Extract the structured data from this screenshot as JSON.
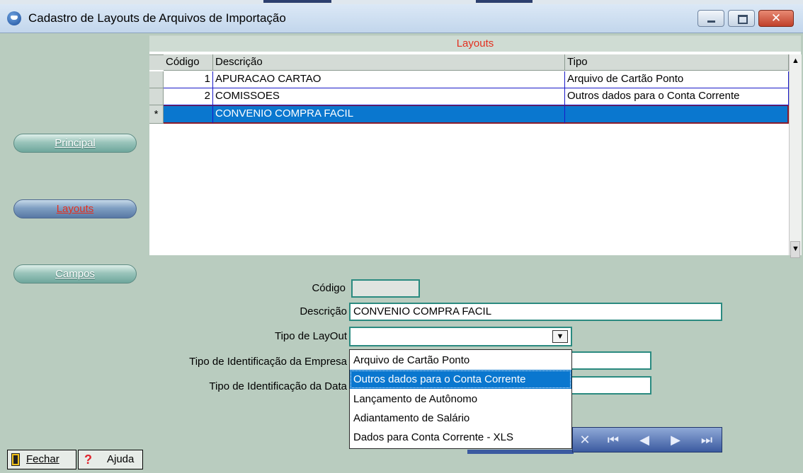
{
  "window": {
    "title": "Cadastro de Layouts de Arquivos de Importação"
  },
  "sidebar": {
    "items": [
      {
        "label": "Principal",
        "active": false
      },
      {
        "label": "Layouts",
        "active": true
      },
      {
        "label": "Campos",
        "active": false
      }
    ],
    "close_label": "Fechar",
    "help_label": "Ajuda"
  },
  "grid": {
    "caption": "Layouts",
    "columns": [
      "Código",
      "Descrição",
      "Tipo"
    ],
    "new_row_marker": "*",
    "rows": [
      {
        "codigo": "1",
        "descricao": "APURACAO CARTAO",
        "tipo": "Arquivo de Cartão Ponto"
      },
      {
        "codigo": "2",
        "descricao": "COMISSOES",
        "tipo": "Outros dados para o Conta Corrente"
      },
      {
        "codigo": "",
        "descricao": "CONVENIO COMPRA FACIL",
        "tipo": ""
      }
    ],
    "selected_row": 2
  },
  "form": {
    "codigo_label": "Código",
    "codigo_value": "",
    "descricao_label": "Descrição",
    "descricao_value": "CONVENIO COMPRA FACIL",
    "tipo_layout_label": "Tipo de LayOut",
    "tipo_layout_value": "",
    "tipo_id_empresa_label": "Tipo de Identificação da Empresa",
    "tipo_id_data_label": "Tipo de Identificação da Data"
  },
  "dropdown": {
    "options": [
      "Arquivo de Cartão Ponto",
      "Outros dados para o Conta Corrente",
      "Lançamento de Autônomo",
      "Adiantamento de Salário",
      "Dados para Conta Corrente - XLS"
    ],
    "highlighted": 1
  },
  "colors": {
    "accent_red": "#e3301f",
    "selection_blue": "#0a77cf",
    "panel_green": "#b9ccbf"
  }
}
